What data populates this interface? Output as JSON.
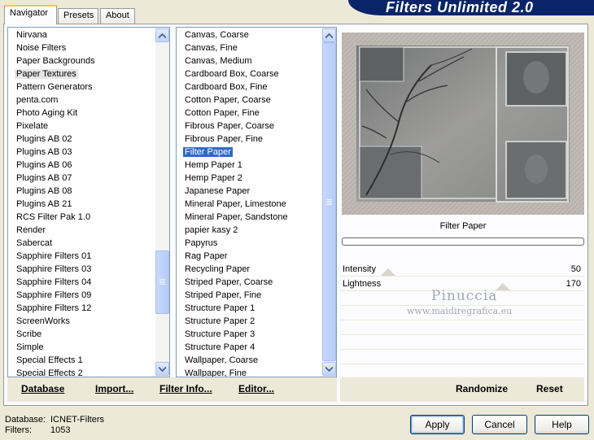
{
  "banner": {
    "title": "Filters Unlimited 2.0"
  },
  "tabs": [
    {
      "label": "Navigator"
    },
    {
      "label": "Presets"
    },
    {
      "label": "About"
    }
  ],
  "categories": {
    "items": [
      "Nirvana",
      "Noise Filters",
      "Paper Backgrounds",
      "Paper Textures",
      "Pattern Generators",
      "penta.com",
      "Photo Aging Kit",
      "Pixelate",
      "Plugins AB 02",
      "Plugins AB 03",
      "Plugins AB 06",
      "Plugins AB 07",
      "Plugins AB 08",
      "Plugins AB 21",
      "RCS Filter Pak 1.0",
      "Render",
      "Sabercat",
      "Sapphire Filters 01",
      "Sapphire Filters 03",
      "Sapphire Filters 04",
      "Sapphire Filters 09",
      "Sapphire Filters 12",
      "ScreenWorks",
      "Scribe",
      "Simple",
      "Special Effects 1",
      "Special Effects 2"
    ],
    "selected_index": 3,
    "scroll_fraction": 0.75
  },
  "filters": {
    "items": [
      "Canvas, Coarse",
      "Canvas, Fine",
      "Canvas, Medium",
      "Cardboard Box, Coarse",
      "Cardboard Box, Fine",
      "Cotton Paper, Coarse",
      "Cotton Paper, Fine",
      "Fibrous Paper, Coarse",
      "Fibrous Paper, Fine",
      "Filter Paper",
      "Hemp Paper 1",
      "Hemp Paper 2",
      "Japanese Paper",
      "Mineral Paper, Limestone",
      "Mineral Paper, Sandstone",
      "papier kasy 2",
      "Papyrus",
      "Rag Paper",
      "Recycling Paper",
      "Striped Paper, Coarse",
      "Striped Paper, Fine",
      "Structure Paper 1",
      "Structure Paper 2",
      "Structure Paper 3",
      "Structure Paper 4",
      "Wallpaper, Coarse",
      "Wallpaper, Fine"
    ],
    "selected_index": 9
  },
  "toolbar": {
    "database": "Database",
    "import": "Import...",
    "filter_info": "Filter Info...",
    "editor": "Editor...",
    "randomize": "Randomize",
    "reset": "Reset"
  },
  "preview": {
    "filter_name": "Filter Paper",
    "progress": 0
  },
  "params": [
    {
      "label": "Intensity",
      "value": "50"
    },
    {
      "label": "Lightness",
      "value": "170"
    }
  ],
  "watermark": {
    "line1": "Pinuccia",
    "line2": "www.maidiregrafica.eu"
  },
  "status": {
    "database_label": "Database:",
    "database_value": "ICNET-Filters",
    "filters_label": "Filters:",
    "filters_value": "1053"
  },
  "buttons": {
    "apply": "Apply",
    "cancel": "Cancel",
    "help": "Help"
  },
  "colors": {
    "selection": "#316ac5",
    "banner": "#0a246a",
    "scrollbar": "#c1d3fb"
  },
  "icons": {
    "scroll_up": "triangle-up",
    "scroll_down": "triangle-down"
  }
}
